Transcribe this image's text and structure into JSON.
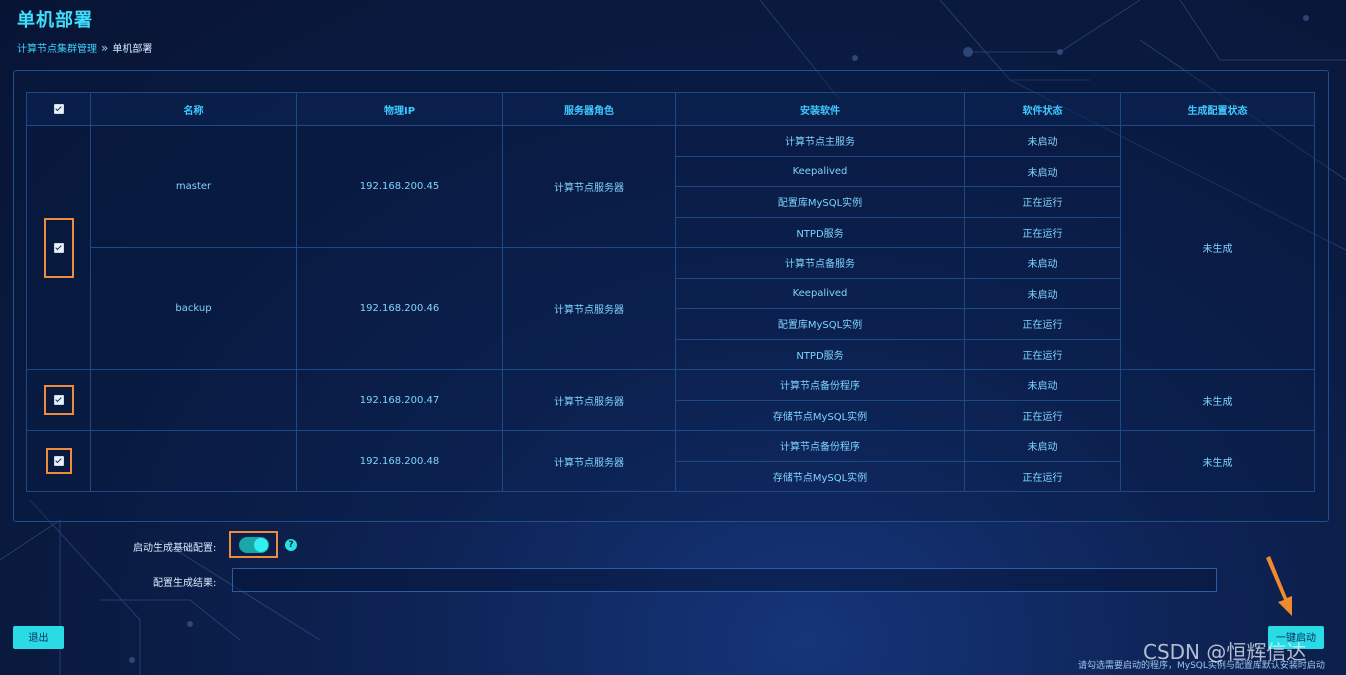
{
  "page": {
    "title": "单机部署",
    "breadcrumb": {
      "parent": "计算节点集群管理",
      "separator": "»",
      "current": "单机部署"
    }
  },
  "table": {
    "headers": [
      "名称",
      "物理IP",
      "服务器角色",
      "安装软件",
      "软件状态",
      "生成配置状态"
    ],
    "groups": [
      {
        "checked": true,
        "config_status": "未生成",
        "servers": [
          {
            "name": "master",
            "ip": "192.168.200.45",
            "role": "计算节点服务器",
            "software": [
              {
                "name": "计算节点主服务",
                "status": "未启动"
              },
              {
                "name": "Keepalived",
                "status": "未启动"
              },
              {
                "name": "配置库MySQL实例",
                "status": "正在运行"
              },
              {
                "name": "NTPD服务",
                "status": "正在运行"
              }
            ]
          },
          {
            "name": "backup",
            "ip": "192.168.200.46",
            "role": "计算节点服务器",
            "software": [
              {
                "name": "计算节点备服务",
                "status": "未启动"
              },
              {
                "name": "Keepalived",
                "status": "未启动"
              },
              {
                "name": "配置库MySQL实例",
                "status": "正在运行"
              },
              {
                "name": "NTPD服务",
                "status": "正在运行"
              }
            ]
          }
        ]
      },
      {
        "checked": true,
        "config_status": "未生成",
        "servers": [
          {
            "name": "",
            "ip": "192.168.200.47",
            "role": "计算节点服务器",
            "software": [
              {
                "name": "计算节点备份程序",
                "status": "未启动"
              },
              {
                "name": "存储节点MySQL实例",
                "status": "正在运行"
              }
            ]
          }
        ]
      },
      {
        "checked": true,
        "config_status": "未生成",
        "servers": [
          {
            "name": "",
            "ip": "192.168.200.48",
            "role": "计算节点服务器",
            "software": [
              {
                "name": "计算节点备份程序",
                "status": "未启动"
              },
              {
                "name": "存储节点MySQL实例",
                "status": "正在运行"
              }
            ]
          }
        ]
      }
    ]
  },
  "form": {
    "auto_config_label": "启动生成基础配置:",
    "auto_config_enabled": true,
    "help_glyph": "?",
    "result_label": "配置生成结果:",
    "result_value": ""
  },
  "buttons": {
    "exit": "退出",
    "start": "一键启动"
  },
  "hint": "请勾选需要启动的程序，MySQL实例与配置库默认安装时启动",
  "watermark": "CSDN @恒辉信达",
  "colors": {
    "accent": "#2adbe6",
    "highlight": "#ef8b3c",
    "title": "#3fe0ff"
  },
  "icons": {
    "arrow": "arrow-annotation-icon",
    "help": "help-icon",
    "checkbox": "checkbox-icon"
  }
}
